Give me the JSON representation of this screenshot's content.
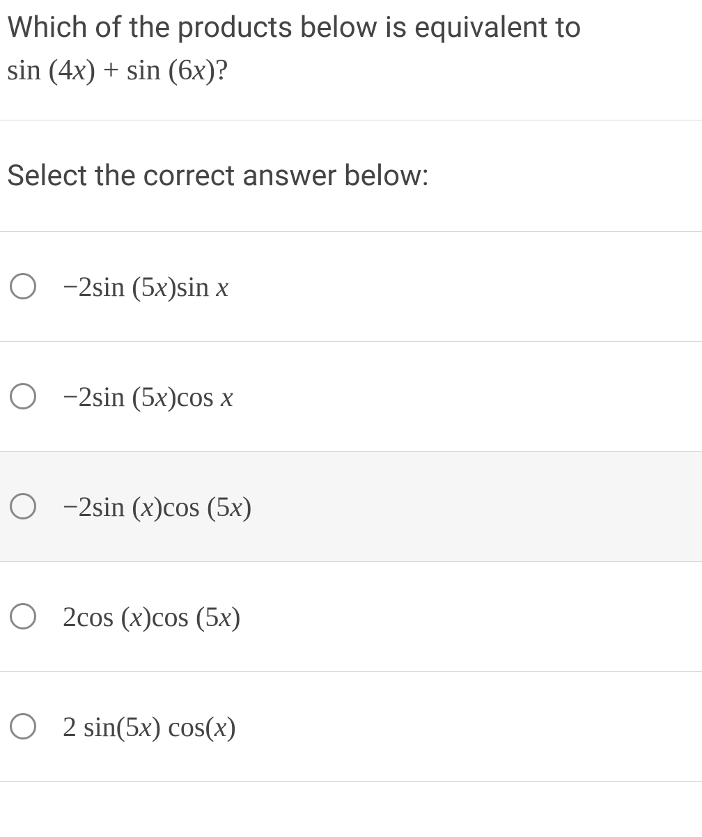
{
  "question": {
    "line1": "Which of the products below is equivalent to",
    "line2_prefix": "sin (4",
    "line2_var1": "x",
    "line2_mid": ") + sin (6",
    "line2_var2": "x",
    "line2_suffix": ")?"
  },
  "instruction": "Select the correct answer below:",
  "options": [
    {
      "prefix": "−2sin (5",
      "var1": "x",
      "mid1": ")sin ",
      "var2": "x",
      "suffix": "",
      "highlighted": false
    },
    {
      "prefix": "−2sin (5",
      "var1": "x",
      "mid1": ")cos ",
      "var2": "x",
      "suffix": "",
      "highlighted": false
    },
    {
      "prefix": "−2sin (",
      "var1": "x",
      "mid1": ")cos (5",
      "var2": "x",
      "suffix": ")",
      "highlighted": true
    },
    {
      "prefix": "2cos (",
      "var1": "x",
      "mid1": ")cos (5",
      "var2": "x",
      "suffix": ")",
      "highlighted": false
    },
    {
      "prefix": "2 sin(5",
      "var1": "x",
      "mid1": ") cos(",
      "var2": "x",
      "suffix": ")",
      "highlighted": false
    }
  ]
}
